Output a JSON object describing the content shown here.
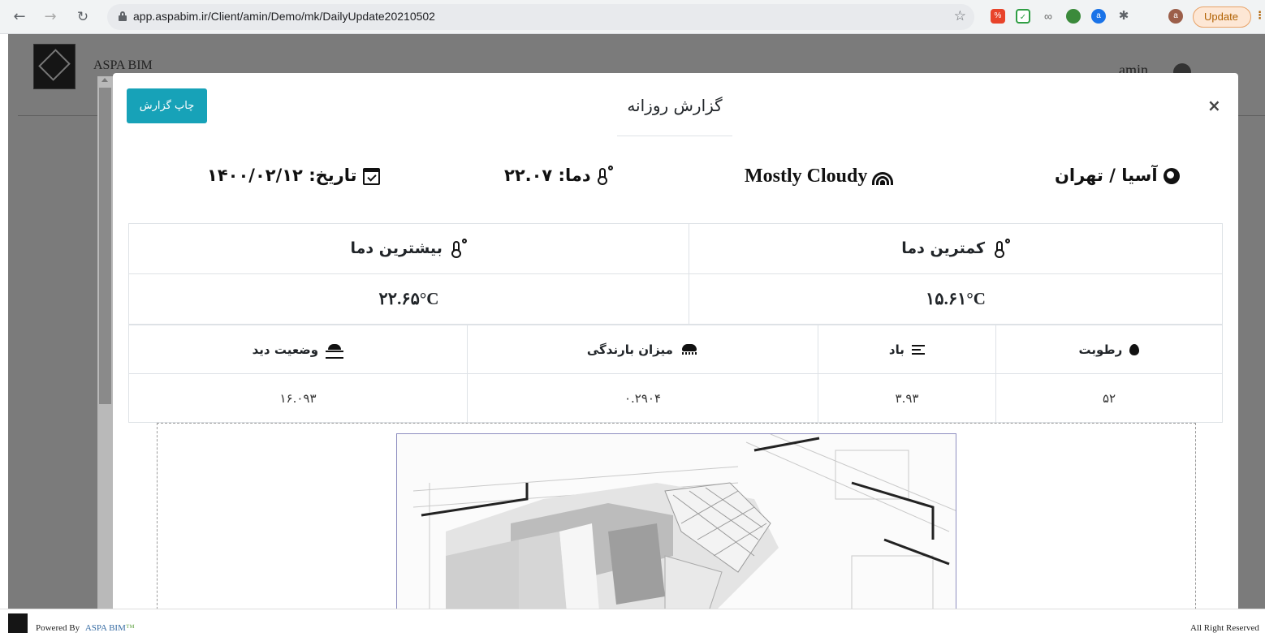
{
  "browser": {
    "url": "app.aspabim.ir/Client/amin/Demo/mk/DailyUpdate20210502",
    "update_label": "Update",
    "profile_initial": "a"
  },
  "app": {
    "name": "ASPA BIM",
    "user": "amin"
  },
  "modal": {
    "title": "گزارش روزانه",
    "print_button": "چاپ گزارش",
    "close": "×",
    "location": "آسیا / تهران",
    "condition": "Mostly Cloudy",
    "temperature": "دما: ۲۲.۰۷",
    "date": "تاریخ: ۱۴۰۰/۰۲/۱۲"
  },
  "minmax": {
    "min_label": "کمترین دما",
    "max_label": "بیشترین دما",
    "min_value": "۱۵.۶۱°C",
    "max_value": "۲۲.۶۵°C"
  },
  "details": {
    "headers": [
      "رطوبت",
      "باد",
      "میزان بارندگی",
      "وضعیت دید"
    ],
    "values": [
      "۵۲",
      "۳.۹۳",
      "۰.۲۹۰۴",
      "۱۶.۰۹۳"
    ]
  },
  "footer": {
    "powered_by": "Powered By",
    "brand": "ASPA BIM",
    "tm": "™",
    "rights": "All Right Reserved"
  },
  "colors": {
    "print_button": "#17a2b8",
    "overlay": "#7b7b7b",
    "update_border": "#e8a267"
  }
}
